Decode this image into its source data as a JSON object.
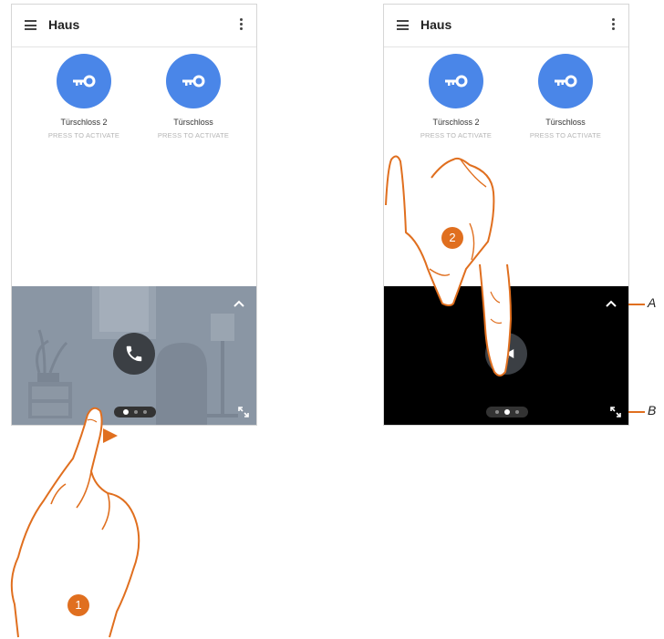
{
  "screens": [
    {
      "app_title": "Haus",
      "locks": [
        {
          "name": "Türschloss 2",
          "status": "PRESS TO ACTIVATE"
        },
        {
          "name": "Türschloss",
          "status": "PRESS TO ACTIVATE"
        }
      ],
      "video_action_icon": "phone-icon",
      "pager": {
        "pages": 3,
        "active": 1
      }
    },
    {
      "app_title": "Haus",
      "locks": [
        {
          "name": "Türschloss 2",
          "status": "PRESS TO ACTIVATE"
        },
        {
          "name": "Türschloss",
          "status": "PRESS TO ACTIVATE"
        }
      ],
      "video_action_icon": "video-camera-icon",
      "pager": {
        "pages": 3,
        "active": 2
      }
    }
  ],
  "steps": [
    "1",
    "2"
  ],
  "callouts": [
    "A",
    "B"
  ],
  "colors": {
    "accent": "#e06f1f",
    "lock_blue": "#4a86e8",
    "video_bg_dark": "#000000",
    "video_bg_preview": "#8a96a4"
  },
  "icons": {
    "menu": "menu-icon",
    "more": "kebab-icon",
    "lock": "key-icon",
    "collapse": "chevron-up-icon",
    "fullscreen": "expand-icon"
  }
}
